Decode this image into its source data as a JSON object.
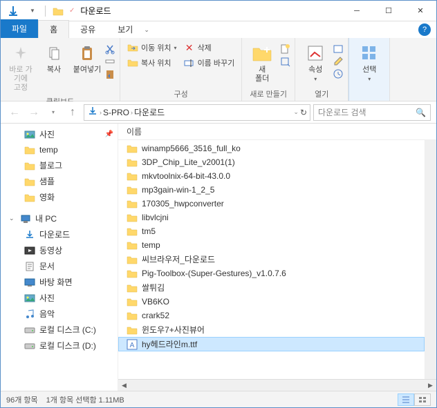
{
  "window_title": "다운로드",
  "tabs": {
    "file": "파일",
    "home": "홈",
    "share": "공유",
    "view": "보기"
  },
  "ribbon": {
    "clipboard": {
      "pin": "바로 가기에\n고정",
      "copy": "복사",
      "paste": "붙여넣기",
      "group_label": "클립보드"
    },
    "organize": {
      "move_to": "이동 위치",
      "copy_to": "복사 위치",
      "delete": "삭제",
      "rename": "이름 바꾸기",
      "group_label": "구성"
    },
    "new": {
      "new_folder": "새\n폴더",
      "group_label": "새로 만들기"
    },
    "open": {
      "properties": "속성",
      "group_label": "열기"
    },
    "select": {
      "select": "선택",
      "group_label": ""
    }
  },
  "address": {
    "segments": [
      "S-PRO",
      "다운로드"
    ]
  },
  "search": {
    "placeholder": "다운로드 검색"
  },
  "nav_pane": {
    "quick": [
      {
        "label": "사진",
        "icon": "pictures",
        "pinned": true
      },
      {
        "label": "temp",
        "icon": "folder"
      },
      {
        "label": "블로그",
        "icon": "folder"
      },
      {
        "label": "샘플",
        "icon": "folder"
      },
      {
        "label": "영화",
        "icon": "folder"
      }
    ],
    "this_pc_label": "내 PC",
    "this_pc": [
      {
        "label": "다운로드",
        "icon": "downloads"
      },
      {
        "label": "동영상",
        "icon": "videos"
      },
      {
        "label": "문서",
        "icon": "documents"
      },
      {
        "label": "바탕 화면",
        "icon": "desktop"
      },
      {
        "label": "사진",
        "icon": "pictures"
      },
      {
        "label": "음악",
        "icon": "music"
      },
      {
        "label": "로컬 디스크 (C:)",
        "icon": "drive"
      },
      {
        "label": "로컬 디스크 (D:)",
        "icon": "drive"
      }
    ]
  },
  "columns": {
    "name": "이름"
  },
  "files": [
    {
      "name": "winamp5666_3516_full_ko",
      "type": "folder"
    },
    {
      "name": "3DP_Chip_Lite_v2001(1)",
      "type": "folder"
    },
    {
      "name": "mkvtoolnix-64-bit-43.0.0",
      "type": "folder"
    },
    {
      "name": "mp3gain-win-1_2_5",
      "type": "folder"
    },
    {
      "name": "170305_hwpconverter",
      "type": "folder"
    },
    {
      "name": "libvlcjni",
      "type": "folder"
    },
    {
      "name": "tm5",
      "type": "folder"
    },
    {
      "name": "temp",
      "type": "folder"
    },
    {
      "name": "씨브라우저_다운로드",
      "type": "folder"
    },
    {
      "name": "Pig-Toolbox-(Super-Gestures)_v1.0.7.6",
      "type": "folder"
    },
    {
      "name": "쌀튀김",
      "type": "folder"
    },
    {
      "name": "VB6KO",
      "type": "folder"
    },
    {
      "name": "crark52",
      "type": "folder"
    },
    {
      "name": "윈도우7+사진뷰어",
      "type": "folder"
    },
    {
      "name": "hy헤드라인m.ttf",
      "type": "font",
      "selected": true
    }
  ],
  "status": {
    "item_count": "96개 항목",
    "selection": "1개 항목 선택함 1.11MB"
  }
}
